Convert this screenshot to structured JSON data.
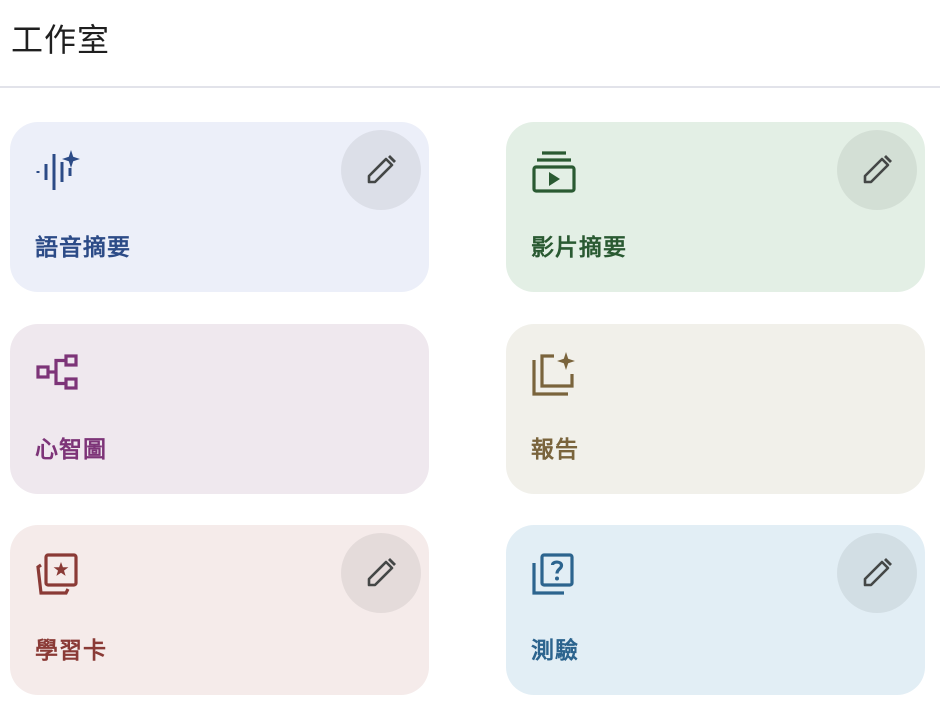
{
  "header": {
    "title": "工作室"
  },
  "cards": [
    {
      "label": "語音摘要",
      "icon": "audio-spark-icon",
      "bg": "#eceff9",
      "fg": "#2c4b87",
      "editable": true
    },
    {
      "label": "影片摘要",
      "icon": "video-playlist-icon",
      "bg": "#e3efe5",
      "fg": "#2a5a32",
      "editable": true
    },
    {
      "label": "心智圖",
      "icon": "mind-map-icon",
      "bg": "#efe8ee",
      "fg": "#7d3478",
      "editable": false
    },
    {
      "label": "報告",
      "icon": "report-spark-icon",
      "bg": "#f1f0ea",
      "fg": "#7a643c",
      "editable": false
    },
    {
      "label": "學習卡",
      "icon": "flashcards-icon",
      "bg": "#f5ebea",
      "fg": "#8a3a36",
      "editable": true
    },
    {
      "label": "測驗",
      "icon": "quiz-icon",
      "bg": "#e2eef5",
      "fg": "#2c648e",
      "editable": true
    }
  ],
  "edit_icon": "pencil-icon"
}
